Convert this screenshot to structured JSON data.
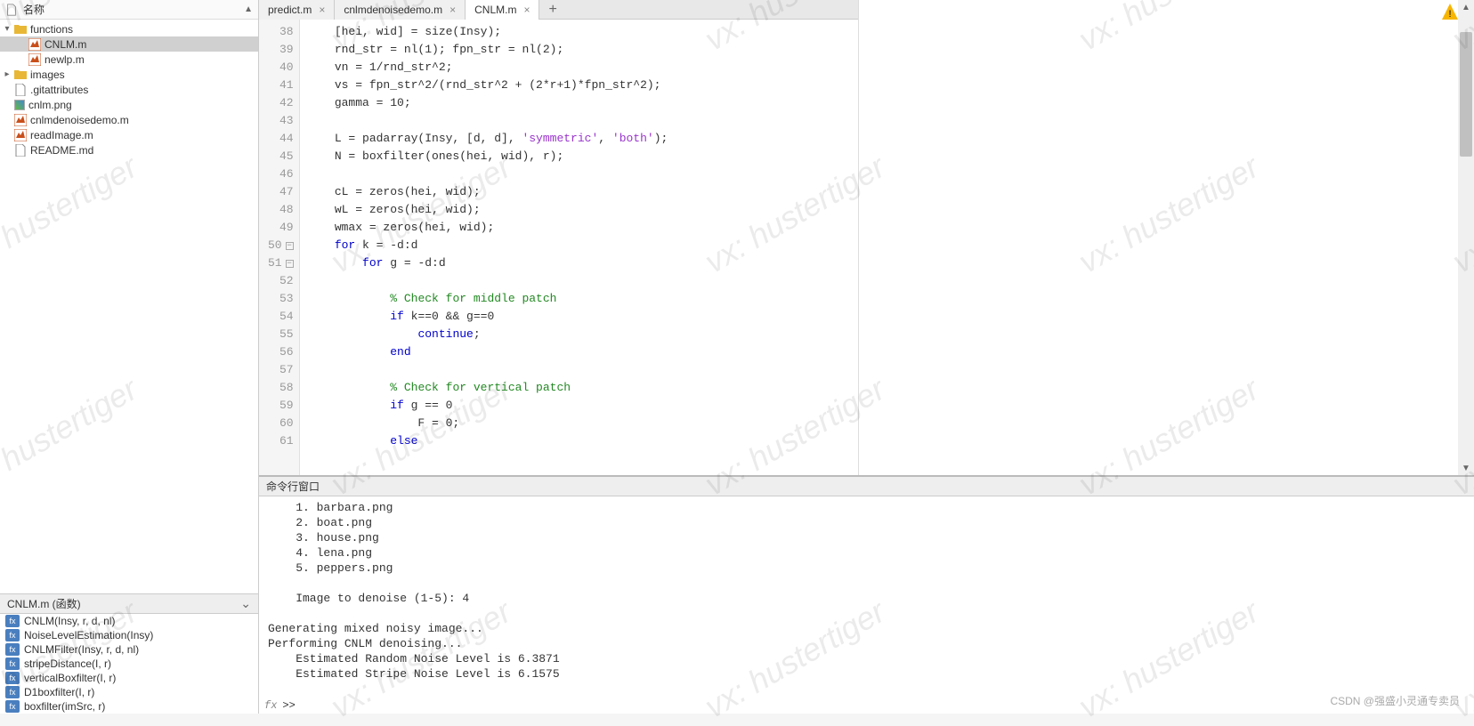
{
  "watermark_text": "vx: hustertiger",
  "csdn_text": "CSDN @强盛小灵通专卖员",
  "tree_header": {
    "label": "名称",
    "sort_glyph": "▲"
  },
  "tree": [
    {
      "indent": 0,
      "exp": "▾",
      "icon": "folder",
      "label": "functions",
      "selected": false
    },
    {
      "indent": 1,
      "exp": "",
      "icon": "matlab",
      "label": "CNLM.m",
      "selected": true
    },
    {
      "indent": 1,
      "exp": "",
      "icon": "matlab",
      "label": "newlp.m",
      "selected": false
    },
    {
      "indent": 0,
      "exp": "▸",
      "icon": "folder",
      "label": "images",
      "selected": false
    },
    {
      "indent": 0,
      "exp": "",
      "icon": "txt",
      "label": ".gitattributes",
      "selected": false
    },
    {
      "indent": 0,
      "exp": "",
      "icon": "png",
      "label": "cnlm.png",
      "selected": false
    },
    {
      "indent": 0,
      "exp": "",
      "icon": "matlab",
      "label": "cnlmdenoisedemo.m",
      "selected": false
    },
    {
      "indent": 0,
      "exp": "",
      "icon": "matlab",
      "label": "readImage.m",
      "selected": false
    },
    {
      "indent": 0,
      "exp": "",
      "icon": "txt",
      "label": "README.md",
      "selected": false
    }
  ],
  "func_header": "CNLM.m  (函数)",
  "functions": [
    "CNLM(Insy, r, d, nl)",
    "NoiseLevelEstimation(Insy)",
    "CNLMFilter(Insy, r, d, nl)",
    "stripeDistance(I, r)",
    "verticalBoxfilter(I, r)",
    "D1boxfilter(I, r)",
    "boxfilter(imSrc, r)"
  ],
  "tabs": [
    {
      "label": "predict.m",
      "active": false
    },
    {
      "label": "cnlmdenoisedemo.m",
      "active": false
    },
    {
      "label": "CNLM.m",
      "active": true
    }
  ],
  "code_lines": [
    {
      "n": 38,
      "html": "    [hei, wid] = size(Insy);"
    },
    {
      "n": 39,
      "html": "    rnd_str = nl(1); fpn_str = nl(2);"
    },
    {
      "n": 40,
      "html": "    vn = 1/rnd_str^2;"
    },
    {
      "n": 41,
      "html": "    vs = fpn_str^2/(rnd_str^2 + (2*r+1)*fpn_str^2);"
    },
    {
      "n": 42,
      "html": "    gamma = 10;"
    },
    {
      "n": 43,
      "html": ""
    },
    {
      "n": 44,
      "html": "    L = padarray(Insy, [d, d], <span class='str'>'symmetric'</span>, <span class='str'>'both'</span>);"
    },
    {
      "n": 45,
      "html": "    N = boxfilter(ones(hei, wid), r);"
    },
    {
      "n": 46,
      "html": ""
    },
    {
      "n": 47,
      "html": "    cL = zeros(hei, wid);"
    },
    {
      "n": 48,
      "html": "    wL = zeros(hei, wid);"
    },
    {
      "n": 49,
      "html": "    wmax = zeros(hei, wid);"
    },
    {
      "n": 50,
      "fold": true,
      "html": "    <span class='kw'>for</span> k = -d:d"
    },
    {
      "n": 51,
      "fold": true,
      "html": "        <span class='kw'>for</span> g = -d:d"
    },
    {
      "n": 52,
      "html": ""
    },
    {
      "n": 53,
      "html": "            <span class='com'>% Check for middle patch</span>"
    },
    {
      "n": 54,
      "html": "            <span class='kw'>if</span> k==0 &amp;&amp; g==0"
    },
    {
      "n": 55,
      "html": "                <span class='kw'>continue</span>;"
    },
    {
      "n": 56,
      "html": "            <span class='kw'>end</span>"
    },
    {
      "n": 57,
      "html": ""
    },
    {
      "n": 58,
      "html": "            <span class='com'>% Check for vertical patch</span>"
    },
    {
      "n": 59,
      "html": "            <span class='kw'>if</span> g == 0"
    },
    {
      "n": 60,
      "html": "                F = 0;"
    },
    {
      "n": 61,
      "html": "            <span class='kw'>else</span>"
    }
  ],
  "cmd_header": "命令行窗口",
  "cmd_output": [
    "    1. barbara.png",
    "    2. boat.png",
    "    3. house.png",
    "    4. lena.png",
    "    5. peppers.png",
    "",
    "    Image to denoise (1-5): 4",
    "",
    "Generating mixed noisy image...",
    "Performing CNLM denoising...",
    "    Estimated Random Noise Level is 6.3871",
    "    Estimated Stripe Noise Level is 6.1575"
  ],
  "cmd_prompt": ">>"
}
